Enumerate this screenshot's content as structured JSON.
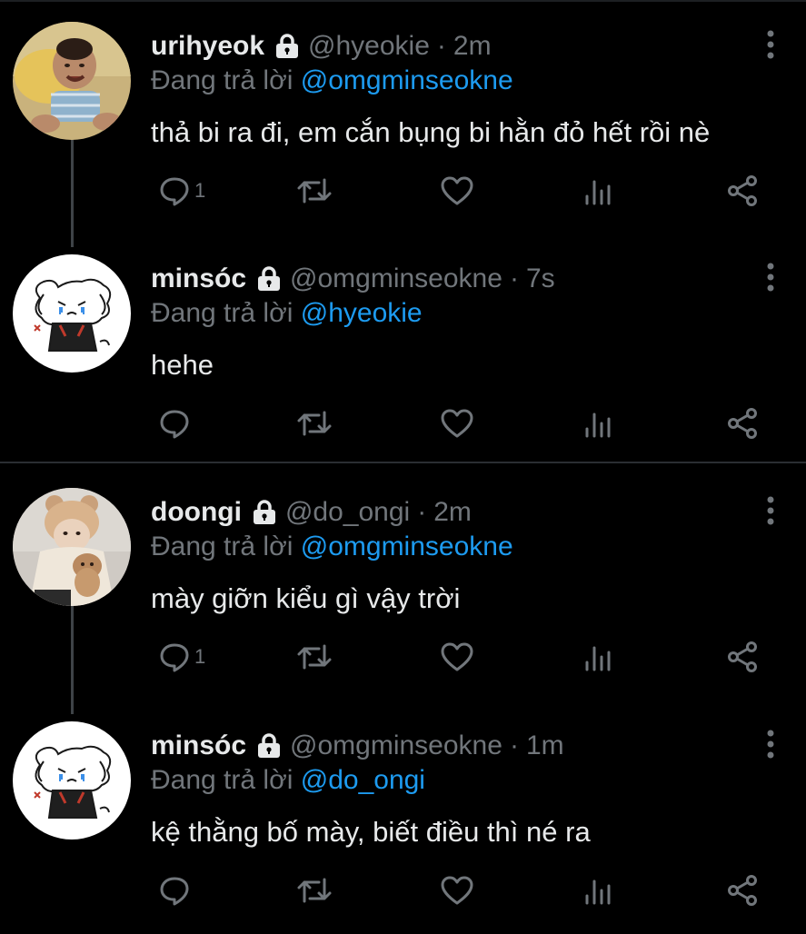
{
  "tweets": [
    {
      "author": "urihyeok",
      "handle": "@hyeokie",
      "time": "2m",
      "replying_label": "Đang trả lời",
      "replying_to": "@omgminseokne",
      "text": "thả bi ra đi, em cắn bụng bi hằn đỏ hết rồi nè",
      "reply_count": "1",
      "avatar": "baby-photo-avatar"
    },
    {
      "author": "minsóc",
      "handle": "@omgminseokne",
      "time": "7s",
      "replying_label": "Đang trả lời",
      "replying_to": "@hyeokie",
      "text": "hehe",
      "reply_count": "",
      "avatar": "crying-dog-drawing-avatar"
    },
    {
      "author": "doongi",
      "handle": "@do_ongi",
      "time": "2m",
      "replying_label": "Đang trả lời",
      "replying_to": "@omgminseokne",
      "text": "mày giỡn kiểu gì vậy trời",
      "reply_count": "1",
      "avatar": "bear-hat-person-avatar"
    },
    {
      "author": "minsóc",
      "handle": "@omgminseokne",
      "time": "1m",
      "replying_label": "Đang trả lời",
      "replying_to": "@do_ongi",
      "text": "kệ thằng bố mày, biết điều thì né ra",
      "reply_count": "",
      "avatar": "crying-dog-drawing-avatar"
    }
  ],
  "separator": "·",
  "colors": {
    "background": "#000000",
    "text": "#e7e9ea",
    "muted": "#71767b",
    "accent": "#1d9bf0",
    "connector": "#3e4347"
  },
  "icons": [
    "lock-icon",
    "more-icon",
    "reply-icon",
    "retweet-icon",
    "like-icon",
    "views-icon",
    "share-icon"
  ]
}
